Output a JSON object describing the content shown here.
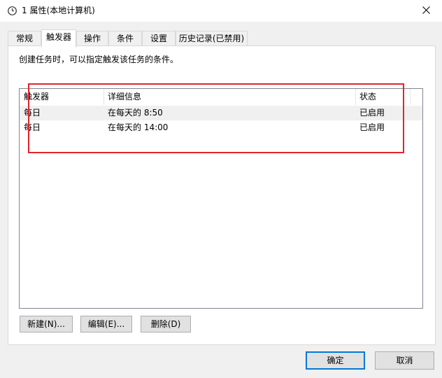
{
  "window": {
    "title": "1 属性(本地计算机)",
    "icon": "clock-icon",
    "close_icon": "close-icon"
  },
  "tabs": [
    {
      "label": "常规"
    },
    {
      "label": "触发器",
      "active": true
    },
    {
      "label": "操作"
    },
    {
      "label": "条件"
    },
    {
      "label": "设置"
    },
    {
      "label": "历史记录(已禁用)"
    }
  ],
  "panel": {
    "description": "创建任务时，可以指定触发该任务的条件。"
  },
  "triggers_table": {
    "columns": [
      "触发器",
      "详细信息",
      "状态"
    ],
    "rows": [
      {
        "trigger": "每日",
        "details": "在每天的 8:50",
        "status": "已启用"
      },
      {
        "trigger": "每日",
        "details": "在每天的 14:00",
        "status": "已启用"
      }
    ]
  },
  "panel_buttons": {
    "new_label": "新建(N)...",
    "edit_label": "编辑(E)...",
    "delete_label": "删除(D)"
  },
  "dialog_buttons": {
    "ok_label": "确定",
    "cancel_label": "取消"
  },
  "colors": {
    "highlight_box": "#e0262c",
    "default_button_border": "#0078d7"
  }
}
